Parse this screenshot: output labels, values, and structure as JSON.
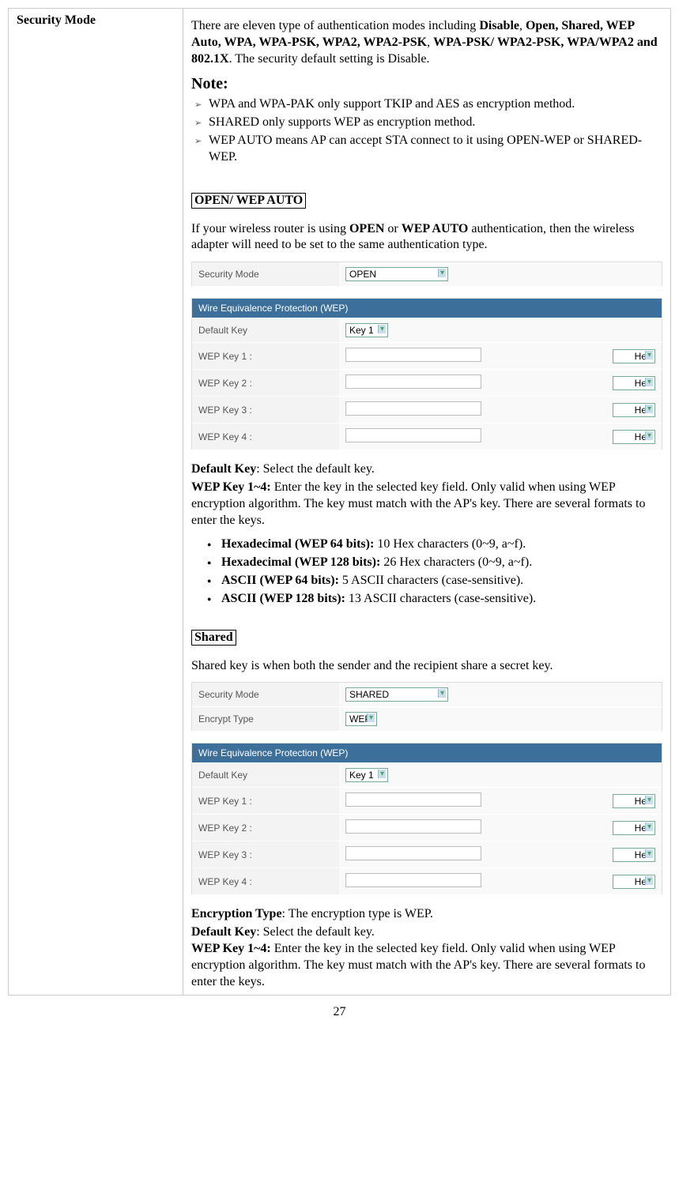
{
  "left_header": "Security Mode",
  "intro_pre": "There are eleven type of authentication modes including ",
  "intro_bold": "Disable",
  "intro_bold2": "Open, Shared, WEP Auto, WPA, WPA-PSK, WPA2, WPA2-PSK",
  "intro_bold3": "WPA-PSK/ WPA2-PSK, WPA/WPA2 and 802.1X",
  "intro_tail": ". The security default setting is Disable.",
  "note_title": "Note:",
  "notes": [
    "WPA and WPA-PAK only support TKIP and AES as encryption method.",
    "SHARED only supports WEP as encryption method.",
    "WEP AUTO means AP can accept STA connect to it using OPEN-WEP or SHARED-WEP."
  ],
  "section1_head": "OPEN/ WEP AUTO",
  "section1_text_a": "If your wireless router is using ",
  "section1_bold_open": "OPEN",
  "section1_text_b": " or ",
  "section1_bold_wepauto": "WEP AUTO",
  "section1_text_c": " authentication, then the wireless adapter will need to be set to the same authentication type.",
  "ui1": {
    "secmode_label": "Security Mode",
    "secmode_value": "OPEN",
    "wep_header": "Wire Equivalence Protection (WEP)",
    "defaultkey_label": "Default Key",
    "defaultkey_value": "Key 1",
    "keys": [
      {
        "label": "WEP Key 1 :",
        "fmt": "Hex"
      },
      {
        "label": "WEP Key 2 :",
        "fmt": "Hex"
      },
      {
        "label": "WEP Key 3 :",
        "fmt": "Hex"
      },
      {
        "label": "WEP Key 4 :",
        "fmt": "Hex"
      }
    ]
  },
  "defkey_b": "Default Key",
  "defkey_t": ": Select the default key.",
  "wepk_b": "WEP Key 1~4:",
  "wepk_t": " Enter the key in the selected key field. Only valid when using WEP encryption algorithm. The key must match with the AP's key. There are several formats to enter the keys.",
  "formats": [
    {
      "b": "Hexadecimal (WEP 64 bits):",
      "t": " 10 Hex characters (0~9, a~f)."
    },
    {
      "b": "Hexadecimal (WEP 128 bits):",
      "t": " 26 Hex characters (0~9, a~f)."
    },
    {
      "b": "ASCII (WEP 64 bits):",
      "t": " 5 ASCII characters (case-sensitive)."
    },
    {
      "b": "ASCII (WEP 128 bits):",
      "t": " 13 ASCII characters (case-sensitive)."
    }
  ],
  "section2_head": "Shared",
  "section2_text": "Shared key is when both the sender and the recipient share a secret key.",
  "ui2": {
    "secmode_label": "Security Mode",
    "secmode_value": "SHARED",
    "encrypt_label": "Encrypt Type",
    "encrypt_value": "WEP",
    "wep_header": "Wire Equivalence Protection (WEP)",
    "defaultkey_label": "Default Key",
    "defaultkey_value": "Key 1",
    "keys": [
      {
        "label": "WEP Key 1 :",
        "fmt": "Hex"
      },
      {
        "label": "WEP Key 2 :",
        "fmt": "Hex"
      },
      {
        "label": "WEP Key 3 :",
        "fmt": "Hex"
      },
      {
        "label": "WEP Key 4 :",
        "fmt": "Hex"
      }
    ]
  },
  "enc_b": "Encryption Type",
  "enc_t": ": The encryption type is WEP.",
  "pagenum": "27"
}
